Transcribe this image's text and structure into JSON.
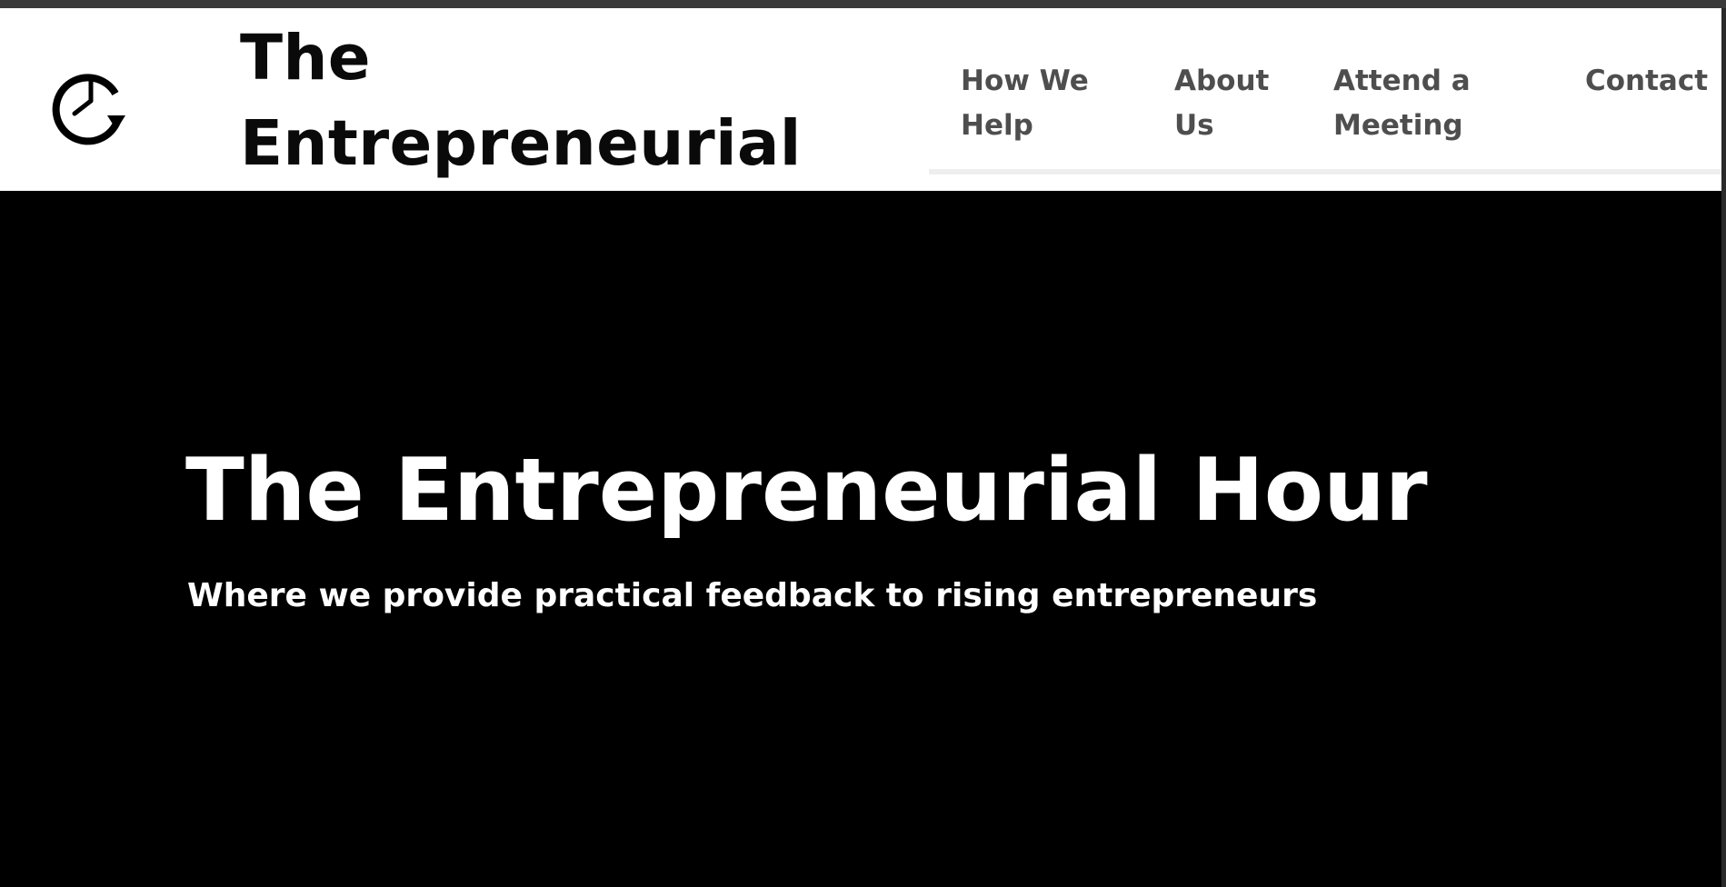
{
  "header": {
    "site_title": "The Entrepreneurial Hour",
    "logo_icon": "clock-refresh-icon"
  },
  "nav": {
    "items": [
      {
        "label": "How We Help"
      },
      {
        "label": "About Us"
      },
      {
        "label": "Attend a Meeting"
      },
      {
        "label": "Contact"
      }
    ]
  },
  "hero": {
    "title": "The Entrepreneurial Hour",
    "subtitle": "Where we provide practical feedback to rising entrepreneurs"
  },
  "colors": {
    "hero_background": "#000000",
    "nav_text": "#4e4e4e",
    "title_text": "#0a0a0a"
  }
}
